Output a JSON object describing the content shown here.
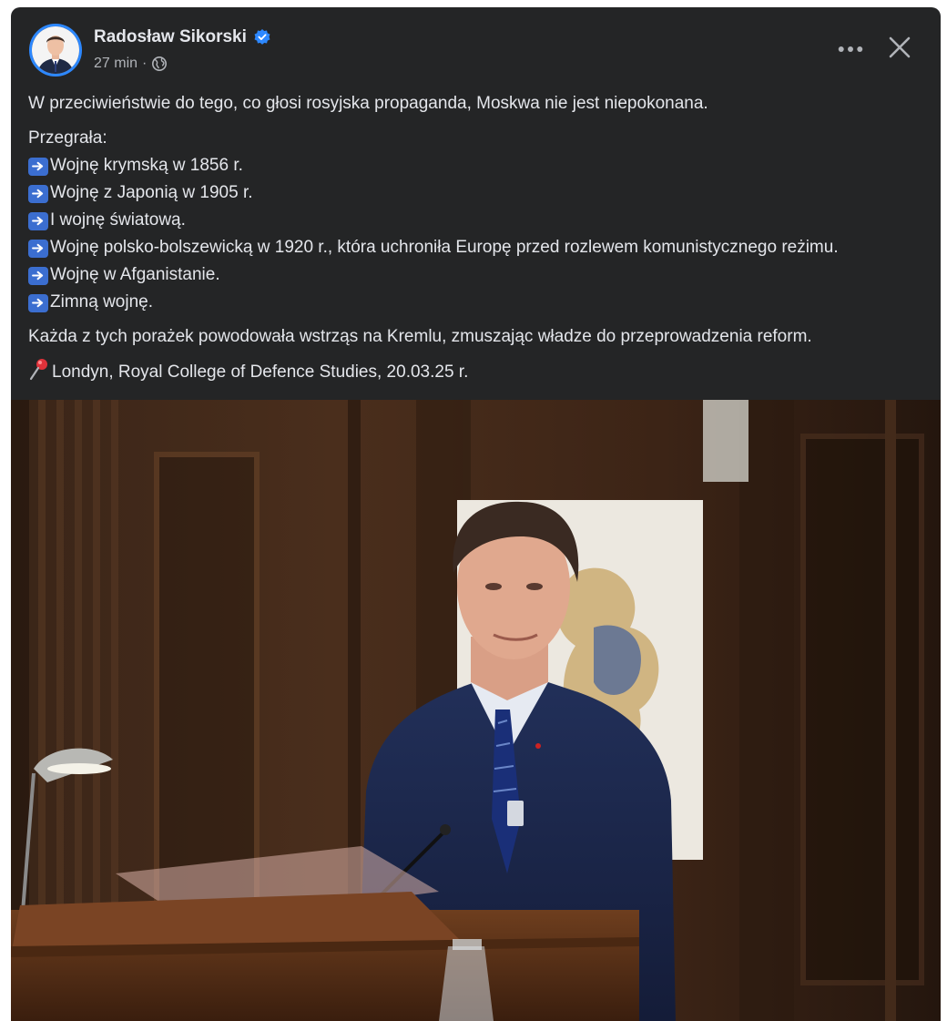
{
  "author": {
    "name": "Radosław Sikorski",
    "verified": true,
    "avatar": "profile-photo"
  },
  "meta": {
    "time": "27 min",
    "separator": "·",
    "audience_icon": "globe-icon"
  },
  "actions": {
    "more_icon": "more-horizontal-icon",
    "close_icon": "close-icon"
  },
  "post": {
    "intro": "W przeciwieństwie do tego, co głosi rosyjska propaganda, Moskwa nie jest niepokonana.",
    "list_heading": "Przegrała:",
    "list_emoji": "right-arrow-emoji",
    "list": [
      "Wojnę krymską w 1856 r.",
      "Wojnę z Japonią w 1905 r.",
      "I wojnę światową.",
      "Wojnę polsko-bolszewicką w 1920 r., która uchroniła Europę przed rozlewem komunistycznego reżimu.",
      "Wojnę w Afganistanie.",
      "Zimną wojnę."
    ],
    "conclusion": "Każda z tych porażek powodowała wstrząs na Kremlu, zmuszając władze do przeprowadzenia reform.",
    "location_emoji": "pushpin-emoji",
    "location": "Londyn, Royal College of Defence Studies, 20.03.25 r."
  },
  "photo": {
    "subject": "speaker-at-lectern-photo"
  },
  "colors": {
    "card_background": "#242526",
    "text_primary": "#e4e6eb",
    "text_secondary": "#b0b3b8",
    "verified_badge": "#2d88ff"
  }
}
